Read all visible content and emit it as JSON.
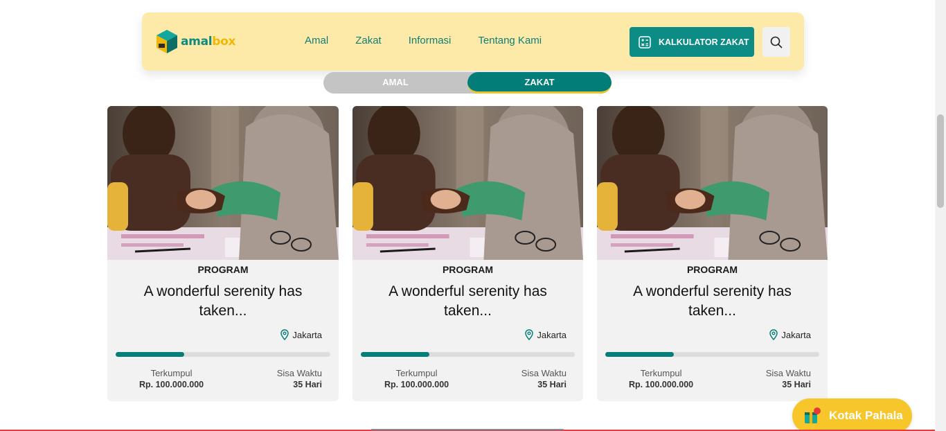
{
  "navbar": {
    "logo": {
      "word_a": "amal",
      "word_b": "box"
    },
    "links": [
      "Amal",
      "Zakat",
      "Informasi",
      "Tentang Kami"
    ],
    "calculator_label": "KALKULATOR ZAKAT"
  },
  "tabs": {
    "amal": "AMAL",
    "zakat": "ZAKAT",
    "active": "zakat"
  },
  "cards": [
    {
      "category": "PROGRAM",
      "title": "A wonderful serenity has taken...",
      "location": "Jakarta",
      "progress": 0.32,
      "collected_label": "Terkumpul",
      "collected_value": "Rp. 100.000.000",
      "time_label": "Sisa Waktu",
      "time_value": "35 Hari"
    },
    {
      "category": "PROGRAM",
      "title": "A wonderful serenity has taken...",
      "location": "Jakarta",
      "progress": 0.32,
      "collected_label": "Terkumpul",
      "collected_value": "Rp. 100.000.000",
      "time_label": "Sisa Waktu",
      "time_value": "35 Hari"
    },
    {
      "category": "PROGRAM",
      "title": "A wonderful serenity has taken...",
      "location": "Jakarta",
      "progress": 0.32,
      "collected_label": "Terkumpul",
      "collected_value": "Rp. 100.000.000",
      "time_label": "Sisa Waktu",
      "time_value": "35 Hari"
    }
  ],
  "floating_button": {
    "label": "Kotak Pahala"
  },
  "colors": {
    "primary": "#027d78",
    "accent": "#f7c62a",
    "nav_bg": "#fde9a8"
  },
  "icons": [
    "logo-cube-icon",
    "calculator-icon",
    "search-icon",
    "location-pin-icon",
    "gift-box-icon"
  ]
}
